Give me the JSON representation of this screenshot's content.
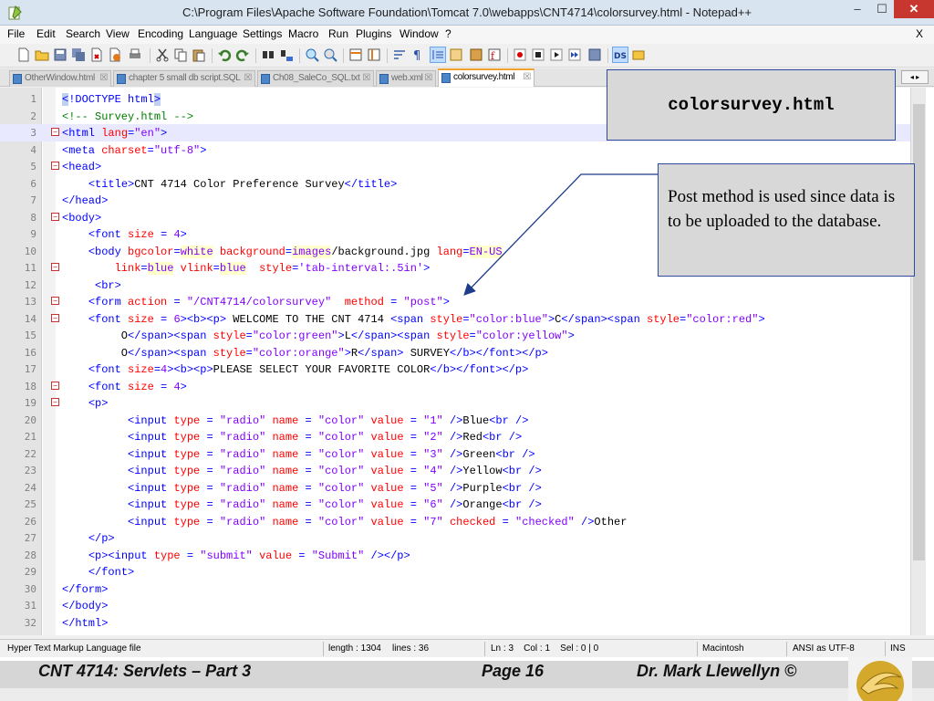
{
  "window": {
    "title": "C:\\Program Files\\Apache Software Foundation\\Tomcat 7.0\\webapps\\CNT4714\\colorsurvey.html - Notepad++",
    "min": "–",
    "max": "☐",
    "close": "✕"
  },
  "menu": {
    "items": [
      "File",
      "Edit",
      "Search",
      "View",
      "Encoding",
      "Language",
      "Settings",
      "Macro",
      "Run",
      "Plugins",
      "Window",
      "?"
    ],
    "close_x": "X"
  },
  "toolbar": {
    "icons": [
      "new-file-icon",
      "open-file-icon",
      "save-icon",
      "save-all-icon",
      "close-icon",
      "close-all-icon",
      "print-icon",
      "cut-icon",
      "copy-icon",
      "paste-icon",
      "undo-icon",
      "redo-icon",
      "find-icon",
      "replace-icon",
      "zoom-in-icon",
      "zoom-out-icon",
      "sync-v-icon",
      "sync-h-icon",
      "wrap-icon",
      "all-chars-icon",
      "indent-guide-icon",
      "udl-icon",
      "doc-map-icon",
      "function-list-icon",
      "record-icon",
      "stop-icon",
      "play-icon",
      "play-multi-icon",
      "save-macro-icon",
      "ds-icon",
      "sheet-icon"
    ]
  },
  "tabs": [
    {
      "label": "OtherWindow.html",
      "active": false
    },
    {
      "label": "chapter 5 small db script.SQL",
      "active": false
    },
    {
      "label": "Ch08_SaleCo_SQL.txt",
      "active": false
    },
    {
      "label": "web.xml",
      "active": false
    },
    {
      "label": "colorsurvey.html",
      "active": true
    }
  ],
  "editor": {
    "current_line": 3,
    "lines": [
      {
        "n": "1"
      },
      {
        "n": "2"
      },
      {
        "n": "3"
      },
      {
        "n": "4"
      },
      {
        "n": "5"
      },
      {
        "n": "6"
      },
      {
        "n": "7"
      },
      {
        "n": "8"
      },
      {
        "n": "9"
      },
      {
        "n": "10"
      },
      {
        "n": "11"
      },
      {
        "n": "12"
      },
      {
        "n": "13"
      },
      {
        "n": "14"
      },
      {
        "n": "15"
      },
      {
        "n": "16"
      },
      {
        "n": "17"
      },
      {
        "n": "18"
      },
      {
        "n": "19"
      },
      {
        "n": "20"
      },
      {
        "n": "21"
      },
      {
        "n": "22"
      },
      {
        "n": "23"
      },
      {
        "n": "24"
      },
      {
        "n": "25"
      },
      {
        "n": "26"
      },
      {
        "n": "27"
      },
      {
        "n": "28"
      },
      {
        "n": "29"
      },
      {
        "n": "30"
      },
      {
        "n": "31"
      },
      {
        "n": "32"
      }
    ]
  },
  "status": {
    "language": "Hyper Text Markup Language file",
    "length": "length : 1304",
    "lines": "lines : 36",
    "position": "Ln : 3    Col : 1    Sel : 0 | 0",
    "eol": "Macintosh",
    "encoding": "ANSI as UTF-8",
    "mode": "INS"
  },
  "callouts": {
    "filename": "colorsurvey.html",
    "note": "Post method is used since data is to be uploaded to the database."
  },
  "footer": {
    "course": "CNT 4714: Servlets – Part 3",
    "page": "Page 16",
    "author": "Dr. Mark Llewellyn ©"
  },
  "colors": {
    "tag": "#0000ff",
    "attribute": "#ff0000",
    "string": "#8000ff",
    "comment": "#008000",
    "active_tab_accent": "#f2a22c"
  }
}
